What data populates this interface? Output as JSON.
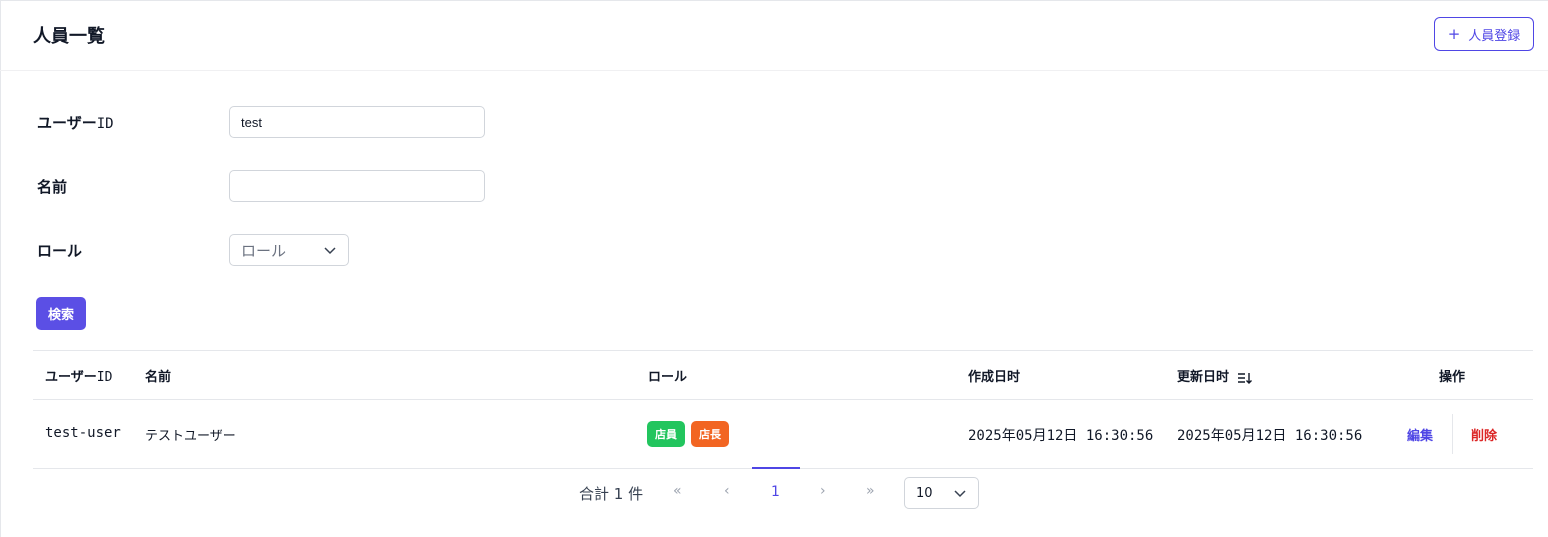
{
  "header": {
    "title": "人員一覧",
    "add_button_icon": "plus-icon",
    "add_button_label": "人員登録",
    "accent_color": "#4f46e5"
  },
  "search_form": {
    "user_id_label_jp": "ユーザー",
    "user_id_label_suffix": "ID",
    "user_id_value": "test",
    "name_label": "名前",
    "name_value": "",
    "role_label": "ロール",
    "role_placeholder": "ロール",
    "search_button_label": "検索"
  },
  "table": {
    "columns": {
      "user_id_jp": "ユーザー",
      "user_id_suffix": "ID",
      "name": "名前",
      "role": "ロール",
      "created": "作成日时",
      "updated": "更新日时",
      "operations": "操作"
    },
    "rows": [
      {
        "user_id": "test-user",
        "name": "テストユーザー",
        "roles": [
          {
            "label": "店員",
            "color": "#22c55e"
          },
          {
            "label": "店長",
            "color": "#f26522"
          }
        ],
        "created": "2025年05月12日 16:30:56",
        "updated": "2025年05月12日 16:30:56",
        "edit_label": "編集",
        "delete_label": "削除"
      }
    ]
  },
  "pagination": {
    "total_text": "合計 1 件",
    "current_page": "1",
    "page_size": "10"
  }
}
